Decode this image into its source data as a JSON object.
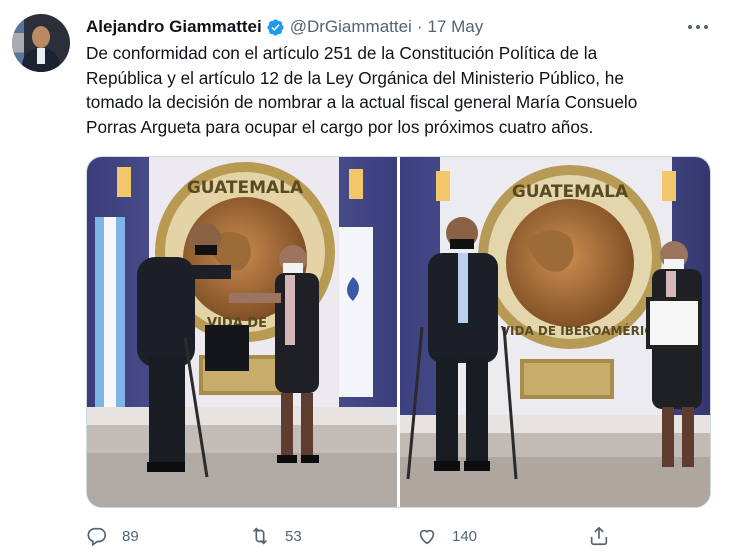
{
  "tweet": {
    "author": {
      "name": "Alejandro Giammattei",
      "handle": "@DrGiammattei",
      "verified": true
    },
    "separator": "·",
    "date": "17 May",
    "text_lines": [
      "De conformidad con el artículo 251 de la Constitución Política de la",
      "República y el artículo 12 de la Ley Orgánica del Ministerio Público, he",
      "tomado la decisión de nombrar a la actual fiscal general María Consuelo",
      "Porras Argueta para ocupar el cargo por los próximos cuatro años."
    ],
    "photos": {
      "left": {
        "seal_text": "GUATEMALA",
        "seal_bottom_text": "VIDA DE"
      },
      "right": {
        "seal_text": "GUATEMALA",
        "seal_bottom_text": "CO VIDA DE IBEROAMÉRICA"
      }
    },
    "actions": {
      "reply": {
        "icon": "reply-icon",
        "count": "89"
      },
      "retweet": {
        "icon": "retweet-icon",
        "count": "53"
      },
      "like": {
        "icon": "heart-icon",
        "count": "140"
      },
      "share": {
        "icon": "share-icon"
      }
    },
    "colors": {
      "text": "#0f1419",
      "secondary": "#536471",
      "verified": "#1d9bf0",
      "border": "#cfd9de"
    }
  }
}
